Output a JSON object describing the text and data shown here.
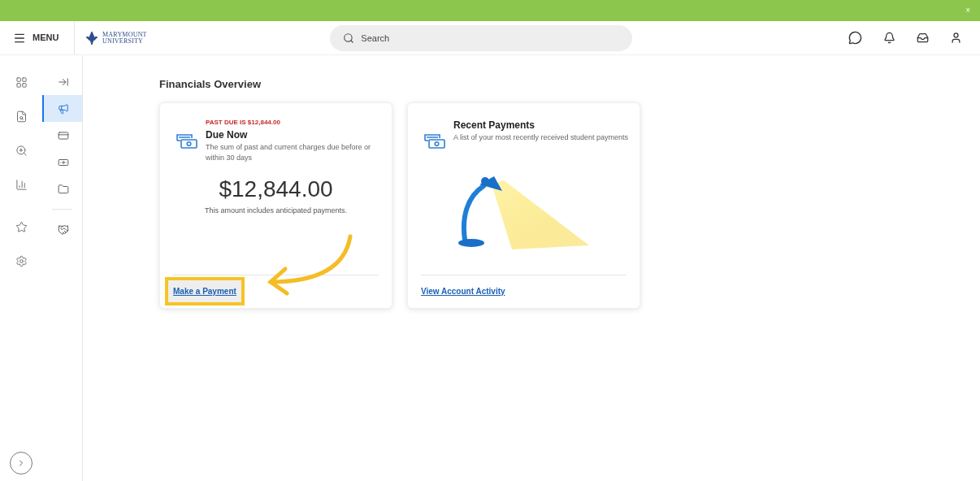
{
  "banner": {
    "close": "×"
  },
  "header": {
    "menu": "MENU",
    "logo": [
      "MARYMOUNT",
      "UNIVERSITY"
    ],
    "search": {
      "placeholder": "Search"
    }
  },
  "rail": [
    {
      "kind": "apps"
    },
    {
      "kind": "report"
    },
    {
      "kind": "search"
    },
    {
      "kind": "chart"
    },
    {
      "kind": "star"
    },
    {
      "kind": "settings"
    }
  ],
  "subrail": [
    {
      "kind": "collapse",
      "selected": false
    },
    {
      "kind": "megaphone",
      "selected": true
    },
    {
      "kind": "card",
      "selected": false
    },
    {
      "kind": "cash",
      "selected": false
    },
    {
      "kind": "folder",
      "selected": false
    },
    {
      "kind": "handshake",
      "selected": false
    }
  ],
  "page": {
    "title": "Financials Overview"
  },
  "cards": [
    {
      "kind": "amount",
      "alert": "PAST DUE IS $12,844.00",
      "title": "Due Now",
      "description": "The sum of past and current charges due before or within 30 days",
      "amount": "$12,844.00",
      "note": "This amount includes anticipated payments.",
      "link": {
        "label": "Make a Payment",
        "highlighted": true
      }
    },
    {
      "title": "Recent Payments",
      "description": "A list of your most recently received student payments",
      "kind": "illustration",
      "link": {
        "label": "View Account Activity",
        "highlighted": false
      }
    }
  ]
}
